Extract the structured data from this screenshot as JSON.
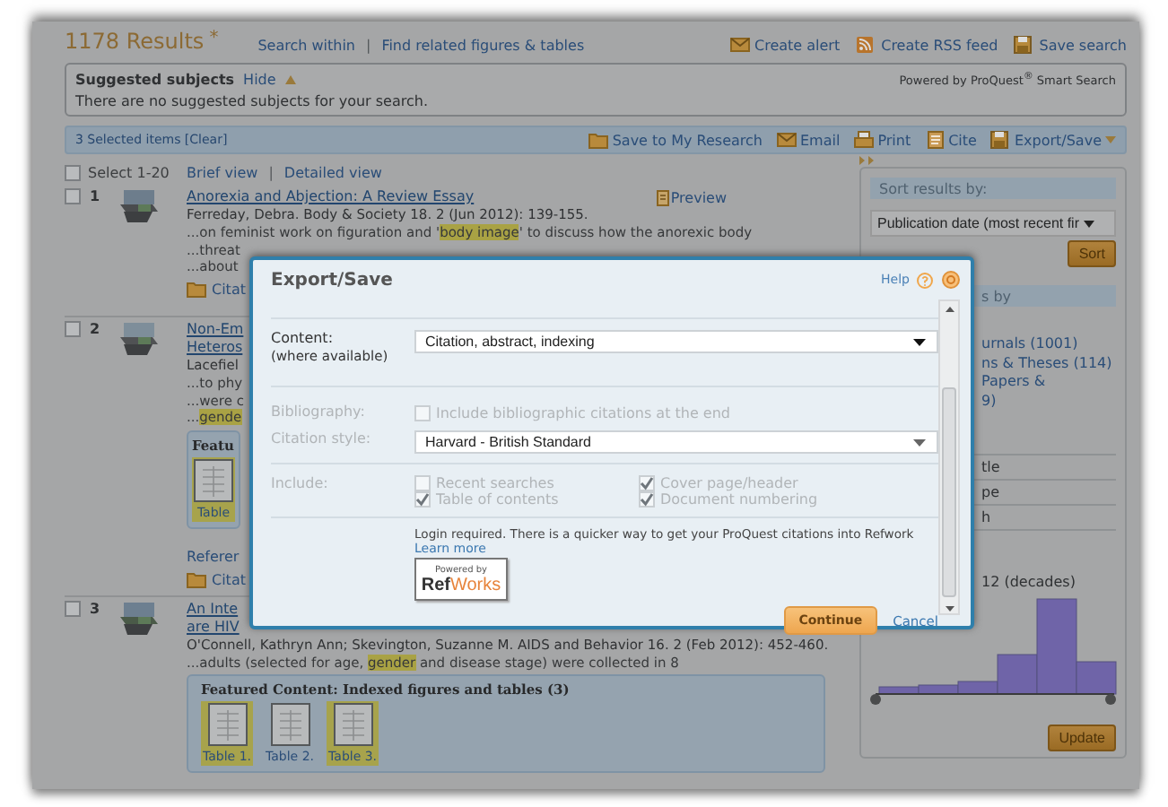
{
  "header": {
    "title": "1178 Results",
    "title_mark": "*",
    "links": [
      "Search within",
      "Find related figures & tables"
    ],
    "separator": "|",
    "actions": [
      "Create alert",
      "Create RSS feed",
      "Save search"
    ]
  },
  "suggested": {
    "title": "Suggested subjects",
    "toggle": "Hide",
    "message": "There are no suggested subjects for your search.",
    "powered": "Powered by ProQuest$^{®}$ Smart Search"
  },
  "selection_bar": {
    "count": "3 Selected items [Clear]",
    "actions": [
      "Save to My Research",
      "Email",
      "Print",
      "Cite",
      "Export/Save"
    ]
  },
  "results": {
    "select_all": {
      "label": "Select 1-20",
      "checked": false
    },
    "views": [
      "Brief view",
      "Detailed view"
    ],
    "view_separator": "|",
    "items": [
      {
        "number": "1",
        "checked": false,
        "title_lines": [
          "Anorexia and Abjection: A Review Essay"
        ],
        "preview": "Preview",
        "byline": "Ferreday, Debra. Body & Society 18. 2 (Jun 2012): 139-155.",
        "snippets": [
          [
            {
              "text": "...on feminist work on figuration and '",
              "highlight": false
            },
            {
              "text": "body image",
              "highlight": true
            },
            {
              "text": "' to discuss how the anorexic body",
              "highlight": false
            }
          ],
          [
            {
              "text": "...threat",
              "highlight": false
            }
          ],
          [
            {
              "text": "...about",
              "highlight": false
            }
          ]
        ],
        "links": [
          {
            "kind": "citation",
            "label": "Citat"
          }
        ]
      },
      {
        "number": "2",
        "checked": false,
        "title_lines": [
          "Non-Em",
          "Heteros"
        ],
        "byline": "Lacefiel",
        "snippets": [
          [
            {
              "text": "...to phy",
              "highlight": false
            }
          ],
          [
            {
              "text": "...were c",
              "highlight": false
            }
          ],
          [
            {
              "text": "...",
              "highlight": false
            },
            {
              "text": "gende",
              "highlight": true
            }
          ]
        ],
        "featured": {
          "title": "Featu",
          "tables": [
            {
              "label": "Table",
              "highlighted": true
            }
          ]
        },
        "links": [
          {
            "kind": "plain",
            "label": "Referer"
          },
          {
            "kind": "citation",
            "label": "Citat"
          }
        ]
      },
      {
        "number": "3",
        "checked": false,
        "title_lines": [
          "An Inte",
          "are HIV"
        ],
        "byline": "O'Connell, Kathryn Ann; Skevington, Suzanne M. AIDS and Behavior 16. 2 (Feb 2012): 452-460.",
        "snippets": [
          [
            {
              "text": "...adults (selected for age, ",
              "highlight": false
            },
            {
              "text": "gender",
              "highlight": true
            },
            {
              "text": " and disease stage) were collected in 8",
              "highlight": false
            }
          ]
        ],
        "featured": {
          "title": "Featured Content: Indexed figures and tables (3)",
          "tables": [
            {
              "label": "Table 1.",
              "highlighted": true
            },
            {
              "label": "Table 2.",
              "highlighted": false
            },
            {
              "label": "Table 3.",
              "highlighted": true
            }
          ]
        }
      }
    ]
  },
  "sidebar": {
    "sort": {
      "heading": "Sort results by:",
      "value": "Publication date (most recent fir",
      "button": "Sort"
    },
    "filter": {
      "heading": "s by",
      "items": [
        "urnals (1001)",
        "ns & Theses (114)",
        "Papers &",
        "9)"
      ]
    },
    "facets": [
      "tle",
      "pe",
      "h"
    ],
    "date_range": {
      "label": "12 (decades)",
      "button": "Update"
    }
  },
  "modal": {
    "title": "Export/Save",
    "help": "Help",
    "fields": [
      {
        "kind": "select",
        "label": "Content:",
        "sublabel": "(where available)",
        "value": "Citation, abstract, indexing",
        "disabled": false
      },
      {
        "kind": "checkbox",
        "label": "Bibliography:",
        "option": "Include bibliographic citations at the end",
        "checked": false,
        "disabled": true
      },
      {
        "kind": "select",
        "label": "Citation style:",
        "value": "Harvard - British Standard",
        "disabled": true
      },
      {
        "kind": "checkgroup",
        "label": "Include:",
        "disabled": true,
        "options": [
          {
            "label": "Recent searches",
            "checked": false
          },
          {
            "label": "Cover page/header",
            "checked": true
          },
          {
            "label": "Table of contents",
            "checked": true
          },
          {
            "label": "Document numbering",
            "checked": true
          }
        ]
      }
    ],
    "notice": "Login required. There is a quicker way to get your ProQuest citations into Refwork",
    "learn_more": "Learn more",
    "badge": {
      "caption": "Powered by",
      "brand_parts": [
        "Ref",
        "Works"
      ]
    },
    "primary": "Continue",
    "cancel": "Cancel"
  }
}
